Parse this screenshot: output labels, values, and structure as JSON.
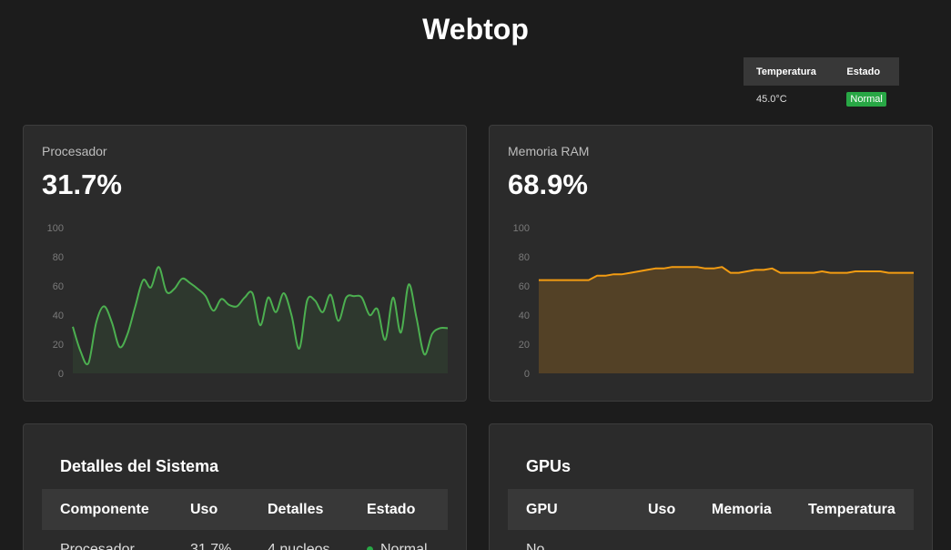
{
  "header": {
    "title": "Webtop"
  },
  "temperature_table": {
    "headers": [
      "Temperatura",
      "Estado"
    ],
    "row": {
      "temp": "45.0°C",
      "status": "Normal"
    }
  },
  "cpu_card": {
    "label": "Procesador",
    "value": "31.7%"
  },
  "ram_card": {
    "label": "Memoria RAM",
    "value": "68.9%"
  },
  "colors": {
    "cpu_line": "#4caf50",
    "ram_line": "#f39c12",
    "status_ok": "#28a745"
  },
  "details": {
    "title": "Detalles del Sistema",
    "headers": [
      "Componente",
      "Uso",
      "Detalles",
      "Estado"
    ],
    "rows": [
      {
        "component": "Procesador",
        "usage": "31.7%",
        "details": "4 nucleos",
        "status": "Normal"
      }
    ]
  },
  "gpus": {
    "title": "GPUs",
    "headers": [
      "GPU",
      "Uso",
      "Memoria",
      "Temperatura"
    ],
    "rows": [
      {
        "gpu": "No"
      }
    ]
  },
  "chart_data": [
    {
      "type": "area",
      "ylim": [
        0,
        100
      ],
      "yticks": [
        "0",
        "20",
        "40",
        "60",
        "80",
        "100"
      ],
      "values": [
        32,
        15,
        7,
        35,
        46,
        35,
        18,
        27,
        46,
        64,
        59,
        73,
        56,
        58,
        65,
        62,
        58,
        53,
        43,
        51,
        47,
        46,
        52,
        55,
        33,
        52,
        42,
        55,
        40,
        17,
        50,
        50,
        42,
        54,
        36,
        52,
        53,
        52,
        40,
        44,
        23,
        52,
        28,
        61,
        38,
        13,
        27,
        31,
        31
      ]
    },
    {
      "type": "area",
      "ylim": [
        0,
        100
      ],
      "yticks": [
        "0",
        "20",
        "40",
        "60",
        "80",
        "100"
      ],
      "values": [
        64,
        64,
        64,
        64,
        64,
        64,
        64,
        67,
        67,
        68,
        68,
        69,
        70,
        71,
        72,
        72,
        73,
        73,
        73,
        73,
        72,
        72,
        73,
        69,
        69,
        70,
        71,
        71,
        72,
        69,
        69,
        69,
        69,
        69,
        70,
        69,
        69,
        69,
        70,
        70,
        70,
        70,
        69,
        69,
        69,
        69
      ]
    }
  ]
}
